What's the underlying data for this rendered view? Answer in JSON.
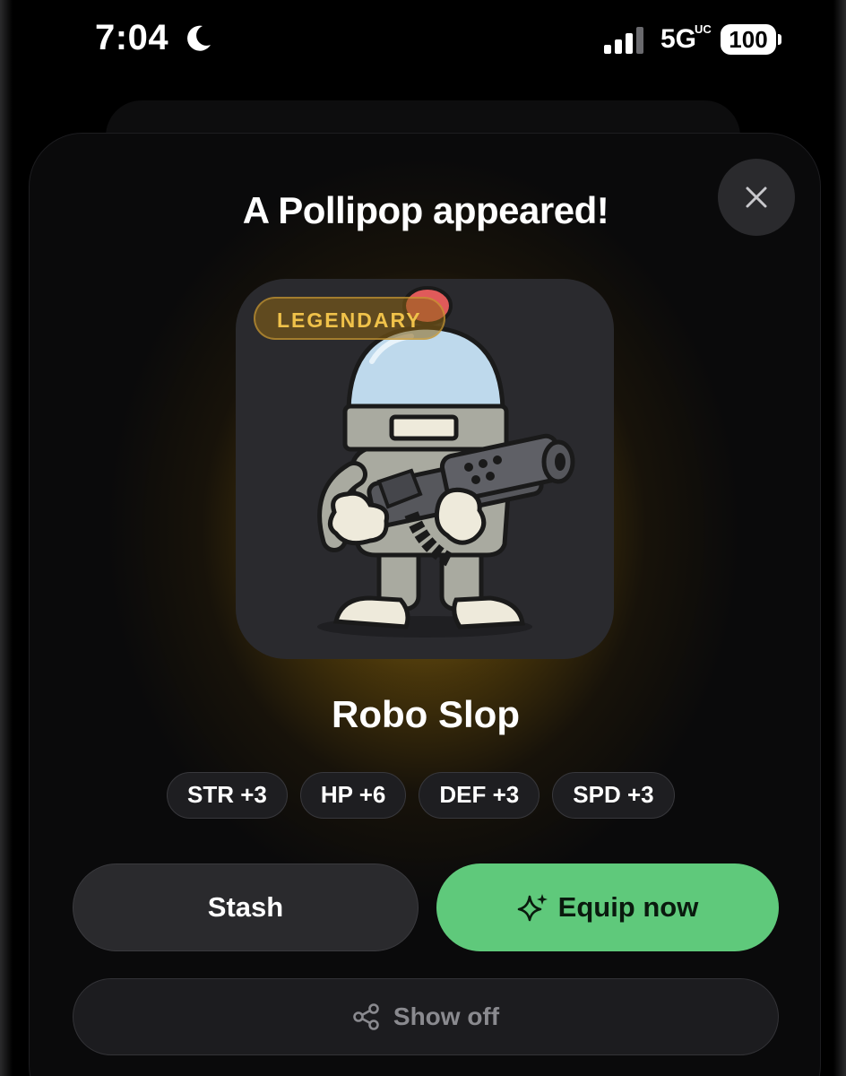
{
  "status_bar": {
    "time": "7:04",
    "network": "5G",
    "network_sub": "UC",
    "battery": "100"
  },
  "modal": {
    "title": "A Pollipop appeared!",
    "rarity": "LEGENDARY",
    "character_name": "Robo Slop",
    "stats": [
      {
        "label": "STR +3"
      },
      {
        "label": "HP +6"
      },
      {
        "label": "DEF +3"
      },
      {
        "label": "SPD +3"
      }
    ],
    "buttons": {
      "stash": "Stash",
      "equip": "Equip now",
      "show_off": "Show off"
    }
  },
  "colors": {
    "accent_green": "#5fc97b",
    "legendary_gold": "#f0c24a",
    "sheet_bg": "#0a0a0b"
  },
  "icons": {
    "close": "close-icon",
    "equip": "sparkle-icon",
    "share": "share-icon",
    "moon": "moon-icon",
    "signal": "signal-icon"
  }
}
